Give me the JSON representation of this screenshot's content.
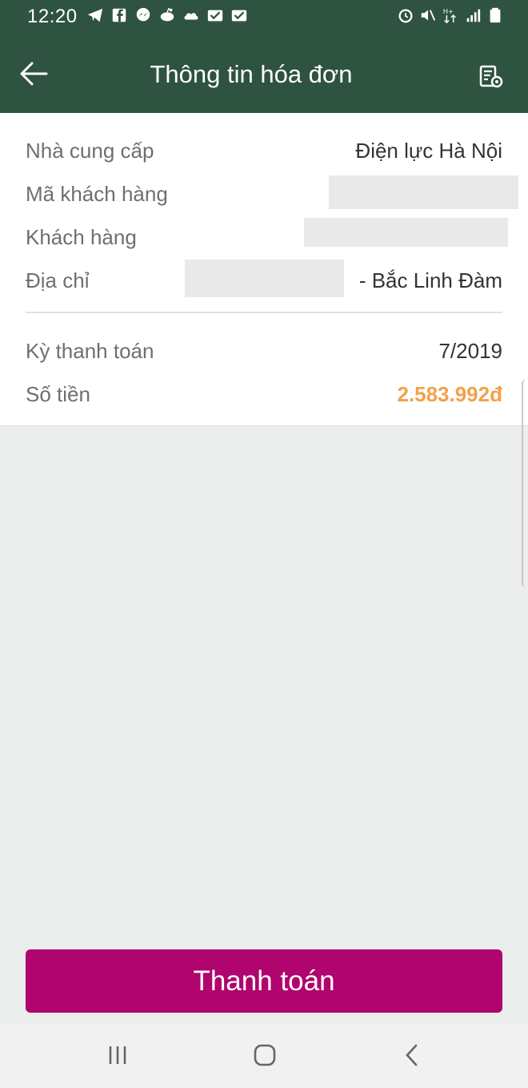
{
  "status_bar": {
    "time": "12:20",
    "left_icons": [
      "telegram-icon",
      "facebook-icon",
      "messenger-icon",
      "reddit-icon",
      "cloud-icon",
      "mail-check-icon",
      "mail-check-icon"
    ],
    "right_icons": [
      "alarm-icon",
      "mute-icon",
      "data-icon",
      "signal-icon",
      "battery-icon"
    ]
  },
  "app_bar": {
    "title": "Thông tin hóa đơn",
    "back_icon": "arrow-left-icon",
    "action_icon": "receipt-settings-icon"
  },
  "bill": {
    "provider_label": "Nhà cung cấp",
    "provider_value": "Điện lực Hà Nội",
    "customer_code_label": "Mã khách hàng",
    "customer_label": "Khách hàng",
    "address_label": "Địa chỉ",
    "address_value": "- Bắc Linh Đàm",
    "period_label": "Kỳ thanh toán",
    "period_value": "7/2019",
    "amount_label": "Số tiền",
    "amount_value": "2.583.992đ"
  },
  "actions": {
    "pay_label": "Thanh toán"
  },
  "colors": {
    "header": "#2e5340",
    "accent_amount": "#f1a24b",
    "pay_button": "#b0046e",
    "background": "#eceeed"
  },
  "nav_bar": {
    "recent_icon": "recent-apps-icon",
    "home_icon": "home-icon",
    "back_icon": "back-chevron-icon"
  }
}
